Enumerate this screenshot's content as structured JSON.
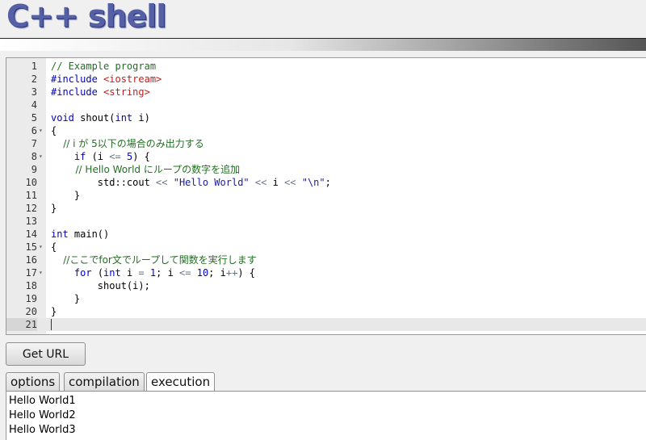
{
  "app": {
    "logo": "C++ shell"
  },
  "editor": {
    "lines": [
      {
        "n": "1",
        "fold": "",
        "parts": [
          {
            "t": "// Example program",
            "c": "cm"
          }
        ]
      },
      {
        "n": "2",
        "fold": "",
        "parts": [
          {
            "t": "#include ",
            "c": "inc"
          },
          {
            "t": "<iostream>",
            "c": "hdr"
          }
        ]
      },
      {
        "n": "3",
        "fold": "",
        "parts": [
          {
            "t": "#include ",
            "c": "inc"
          },
          {
            "t": "<string>",
            "c": "hdr"
          }
        ]
      },
      {
        "n": "4",
        "fold": "",
        "parts": []
      },
      {
        "n": "5",
        "fold": "",
        "parts": [
          {
            "t": "void",
            "c": "kw"
          },
          {
            "t": " shout(",
            "c": ""
          },
          {
            "t": "int",
            "c": "kw"
          },
          {
            "t": " i)",
            "c": ""
          }
        ]
      },
      {
        "n": "6",
        "fold": "▾",
        "parts": [
          {
            "t": "{",
            "c": ""
          }
        ]
      },
      {
        "n": "7",
        "fold": "",
        "parts": [
          {
            "t": "    // i が 5以下の場合のみ出力する",
            "c": "cm"
          }
        ]
      },
      {
        "n": "8",
        "fold": "▾",
        "parts": [
          {
            "t": "    ",
            "c": ""
          },
          {
            "t": "if",
            "c": "kw"
          },
          {
            "t": " (i ",
            "c": ""
          },
          {
            "t": "<=",
            "c": "op"
          },
          {
            "t": " ",
            "c": ""
          },
          {
            "t": "5",
            "c": "num"
          },
          {
            "t": ") {",
            "c": ""
          }
        ]
      },
      {
        "n": "9",
        "fold": "",
        "parts": [
          {
            "t": "        // Hello World にループの数字を追加",
            "c": "cm"
          }
        ]
      },
      {
        "n": "10",
        "fold": "",
        "parts": [
          {
            "t": "        std::cout ",
            "c": ""
          },
          {
            "t": "<<",
            "c": "op"
          },
          {
            "t": " ",
            "c": ""
          },
          {
            "t": "\"Hello World\"",
            "c": "str"
          },
          {
            "t": " ",
            "c": ""
          },
          {
            "t": "<<",
            "c": "op"
          },
          {
            "t": " i ",
            "c": ""
          },
          {
            "t": "<<",
            "c": "op"
          },
          {
            "t": " ",
            "c": ""
          },
          {
            "t": "\"\\n\"",
            "c": "str"
          },
          {
            "t": ";",
            "c": ""
          }
        ]
      },
      {
        "n": "11",
        "fold": "",
        "parts": [
          {
            "t": "    }",
            "c": ""
          }
        ]
      },
      {
        "n": "12",
        "fold": "",
        "parts": [
          {
            "t": "}",
            "c": ""
          }
        ]
      },
      {
        "n": "13",
        "fold": "",
        "parts": []
      },
      {
        "n": "14",
        "fold": "",
        "parts": [
          {
            "t": "int",
            "c": "kw"
          },
          {
            "t": " main()",
            "c": ""
          }
        ]
      },
      {
        "n": "15",
        "fold": "▾",
        "parts": [
          {
            "t": "{",
            "c": ""
          }
        ]
      },
      {
        "n": "16",
        "fold": "",
        "parts": [
          {
            "t": "    //ここでfor文でループして関数を実行します",
            "c": "cm"
          }
        ]
      },
      {
        "n": "17",
        "fold": "▾",
        "parts": [
          {
            "t": "    ",
            "c": ""
          },
          {
            "t": "for",
            "c": "kw"
          },
          {
            "t": " (",
            "c": ""
          },
          {
            "t": "int",
            "c": "kw"
          },
          {
            "t": " i ",
            "c": ""
          },
          {
            "t": "=",
            "c": "op"
          },
          {
            "t": " ",
            "c": ""
          },
          {
            "t": "1",
            "c": "num"
          },
          {
            "t": "; i ",
            "c": ""
          },
          {
            "t": "<=",
            "c": "op"
          },
          {
            "t": " ",
            "c": ""
          },
          {
            "t": "10",
            "c": "num"
          },
          {
            "t": "; i",
            "c": ""
          },
          {
            "t": "++",
            "c": "op"
          },
          {
            "t": ") {",
            "c": ""
          }
        ]
      },
      {
        "n": "18",
        "fold": "",
        "parts": [
          {
            "t": "        shout(i);",
            "c": ""
          }
        ]
      },
      {
        "n": "19",
        "fold": "",
        "parts": [
          {
            "t": "    }",
            "c": ""
          }
        ]
      },
      {
        "n": "20",
        "fold": "",
        "parts": [
          {
            "t": "}",
            "c": ""
          }
        ]
      },
      {
        "n": "21",
        "fold": "",
        "parts": [],
        "active": true
      }
    ]
  },
  "toolbar": {
    "get_url_label": "Get URL"
  },
  "tabs": [
    {
      "label": "options",
      "selected": false
    },
    {
      "label": "compilation",
      "selected": false
    },
    {
      "label": "execution",
      "selected": true
    }
  ],
  "output": {
    "lines": [
      "Hello World1",
      "Hello World2",
      "Hello World3"
    ]
  }
}
